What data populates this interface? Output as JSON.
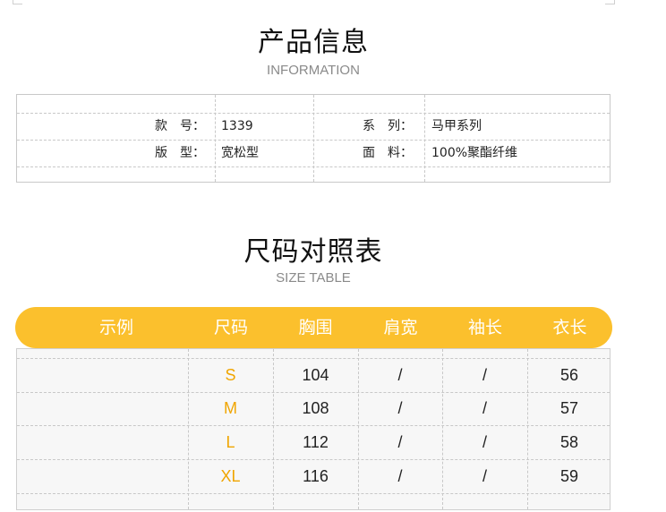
{
  "product_info": {
    "title": "产品信息",
    "subtitle": "INFORMATION",
    "rows": [
      {
        "label1": "款　号：",
        "value1": "1339",
        "label2": "系　列：",
        "value2": "马甲系列"
      },
      {
        "label1": "版　型：",
        "value1": "宽松型",
        "label2": "面　料：",
        "value2": "100%聚酯纤维"
      }
    ]
  },
  "size_table": {
    "title": "尺码对照表",
    "subtitle": "SIZE TABLE",
    "headers": [
      "示例",
      "尺码",
      "胸围",
      "肩宽",
      "袖长",
      "衣长"
    ],
    "rows": [
      {
        "size": "S",
        "chest": "104",
        "shoulder": "/",
        "sleeve": "/",
        "length": "56"
      },
      {
        "size": "M",
        "chest": "108",
        "shoulder": "/",
        "sleeve": "/",
        "length": "57"
      },
      {
        "size": "L",
        "chest": "112",
        "shoulder": "/",
        "sleeve": "/",
        "length": "58"
      },
      {
        "size": "XL",
        "chest": "116",
        "shoulder": "/",
        "sleeve": "/",
        "length": "59"
      }
    ]
  },
  "colors": {
    "accent": "#fbc02d",
    "size_text": "#f0a500"
  }
}
